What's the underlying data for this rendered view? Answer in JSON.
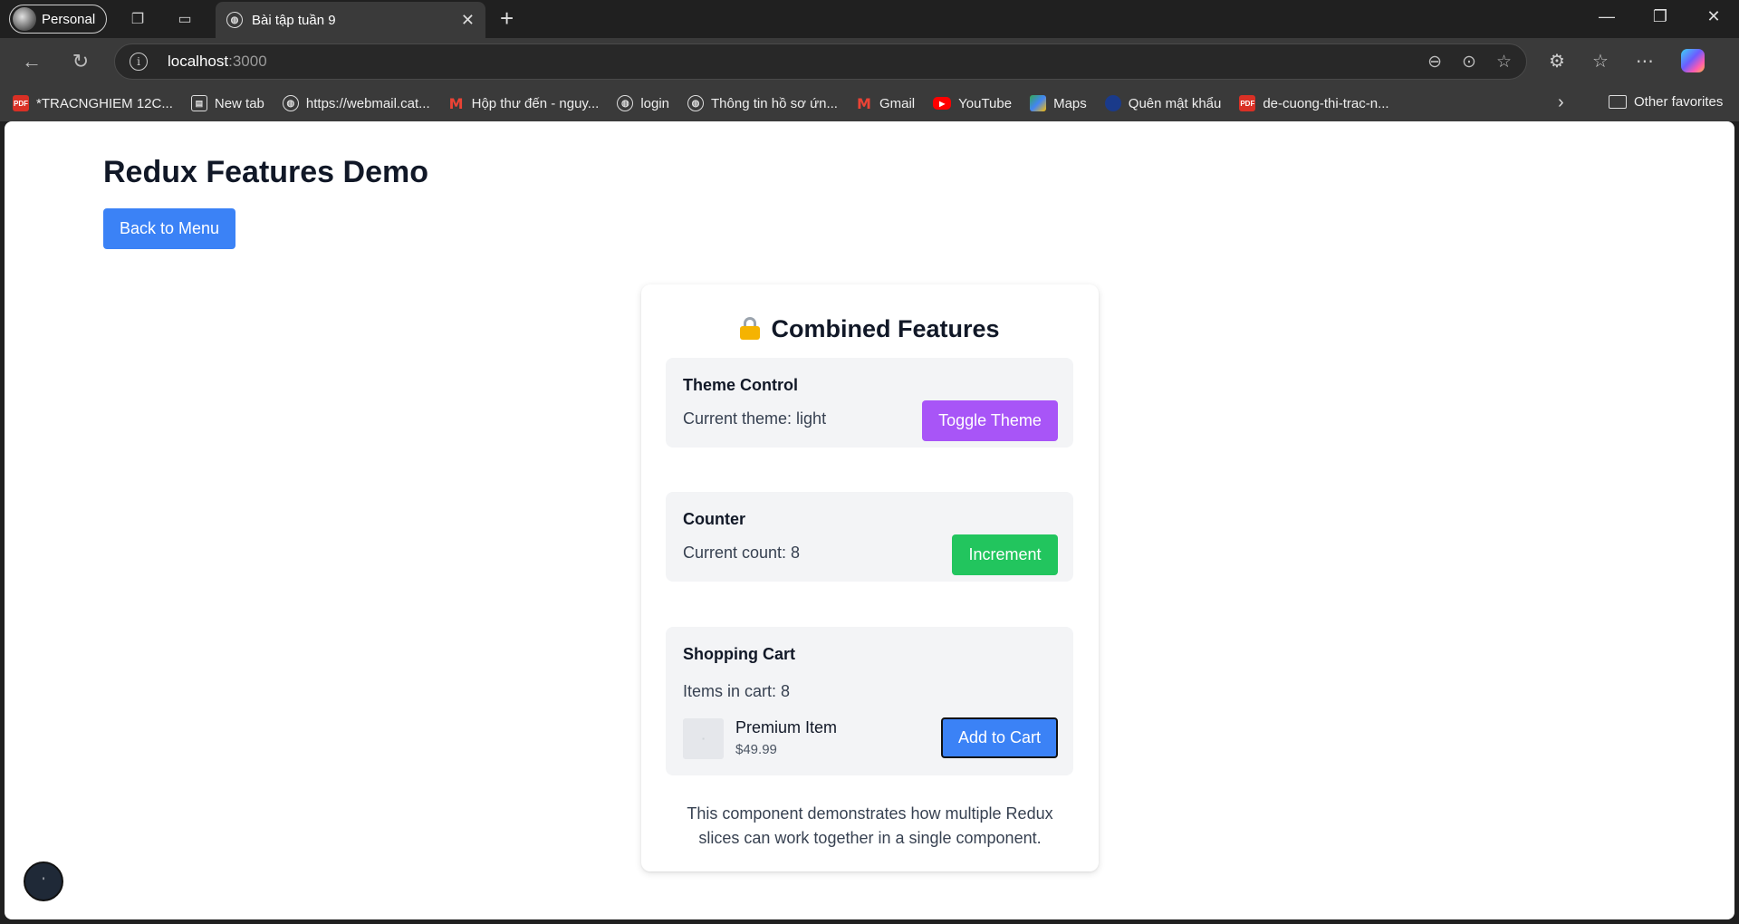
{
  "browser": {
    "profile_label": "Personal",
    "tab_title": "Bài tập tuần 9",
    "url_host": "localhost",
    "url_port": ":3000"
  },
  "bookmarks": {
    "items": [
      {
        "label": "*TRACNGHIEM 12C...",
        "icon": "pdf-icon"
      },
      {
        "label": "New tab",
        "icon": "tab-icon"
      },
      {
        "label": "https://webmail.cat...",
        "icon": "globe-icon"
      },
      {
        "label": "Hộp thư đến - nguy...",
        "icon": "gmail-icon"
      },
      {
        "label": "login",
        "icon": "globe-icon"
      },
      {
        "label": "Thông tin hồ sơ ứn...",
        "icon": "globe-icon"
      },
      {
        "label": "Gmail",
        "icon": "gmail-icon"
      },
      {
        "label": "YouTube",
        "icon": "youtube-icon"
      },
      {
        "label": "Maps",
        "icon": "maps-icon"
      },
      {
        "label": "Quên mật khẩu",
        "icon": "key-icon"
      },
      {
        "label": "de-cuong-thi-trac-n...",
        "icon": "pdf-icon"
      }
    ],
    "other_favorites": "Other favorites"
  },
  "page": {
    "title": "Redux Features Demo",
    "back_button": "Back to Menu",
    "card": {
      "title": "Combined Features",
      "theme": {
        "title": "Theme Control",
        "status": "Current theme: light",
        "button": "Toggle Theme"
      },
      "counter": {
        "title": "Counter",
        "status": "Current count: 8",
        "button": "Increment"
      },
      "cart": {
        "title": "Shopping Cart",
        "status": "Items in cart: 8",
        "item_name": "Premium Item",
        "item_price": "$49.99",
        "button": "Add to Cart"
      },
      "footnote": "This component demonstrates how multiple Redux slices can work together in a single component."
    },
    "devtool_label": "'"
  },
  "colors": {
    "primary": "#3b82f6",
    "purple": "#a855f7",
    "green": "#22c55e",
    "section_bg": "#f3f4f6"
  }
}
